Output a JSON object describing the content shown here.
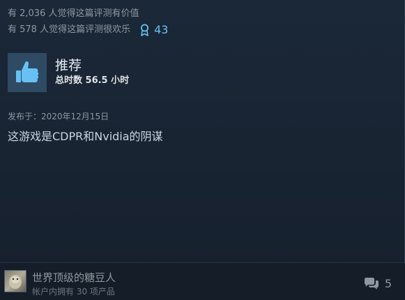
{
  "helpful": {
    "helpful_text": "有 2,036 人觉得这篇评测有价值",
    "funny_text": "有 578 人觉得这篇评测很欢乐"
  },
  "award": {
    "icon": "award-ribbon-icon",
    "count": "43",
    "color": "#66c0f4"
  },
  "recommendation": {
    "icon": "thumbs-up-icon",
    "label": "推荐",
    "hours": "总时数 56.5 小时"
  },
  "review": {
    "posted": "发布于：2020年12月15日",
    "text": "这游戏是CDPR和Nvidia的阴谋"
  },
  "author": {
    "name": "世界顶级的糖豆人",
    "products": "帐户内拥有 30 项产品"
  },
  "comments": {
    "icon": "comment-icon",
    "count": "5"
  }
}
